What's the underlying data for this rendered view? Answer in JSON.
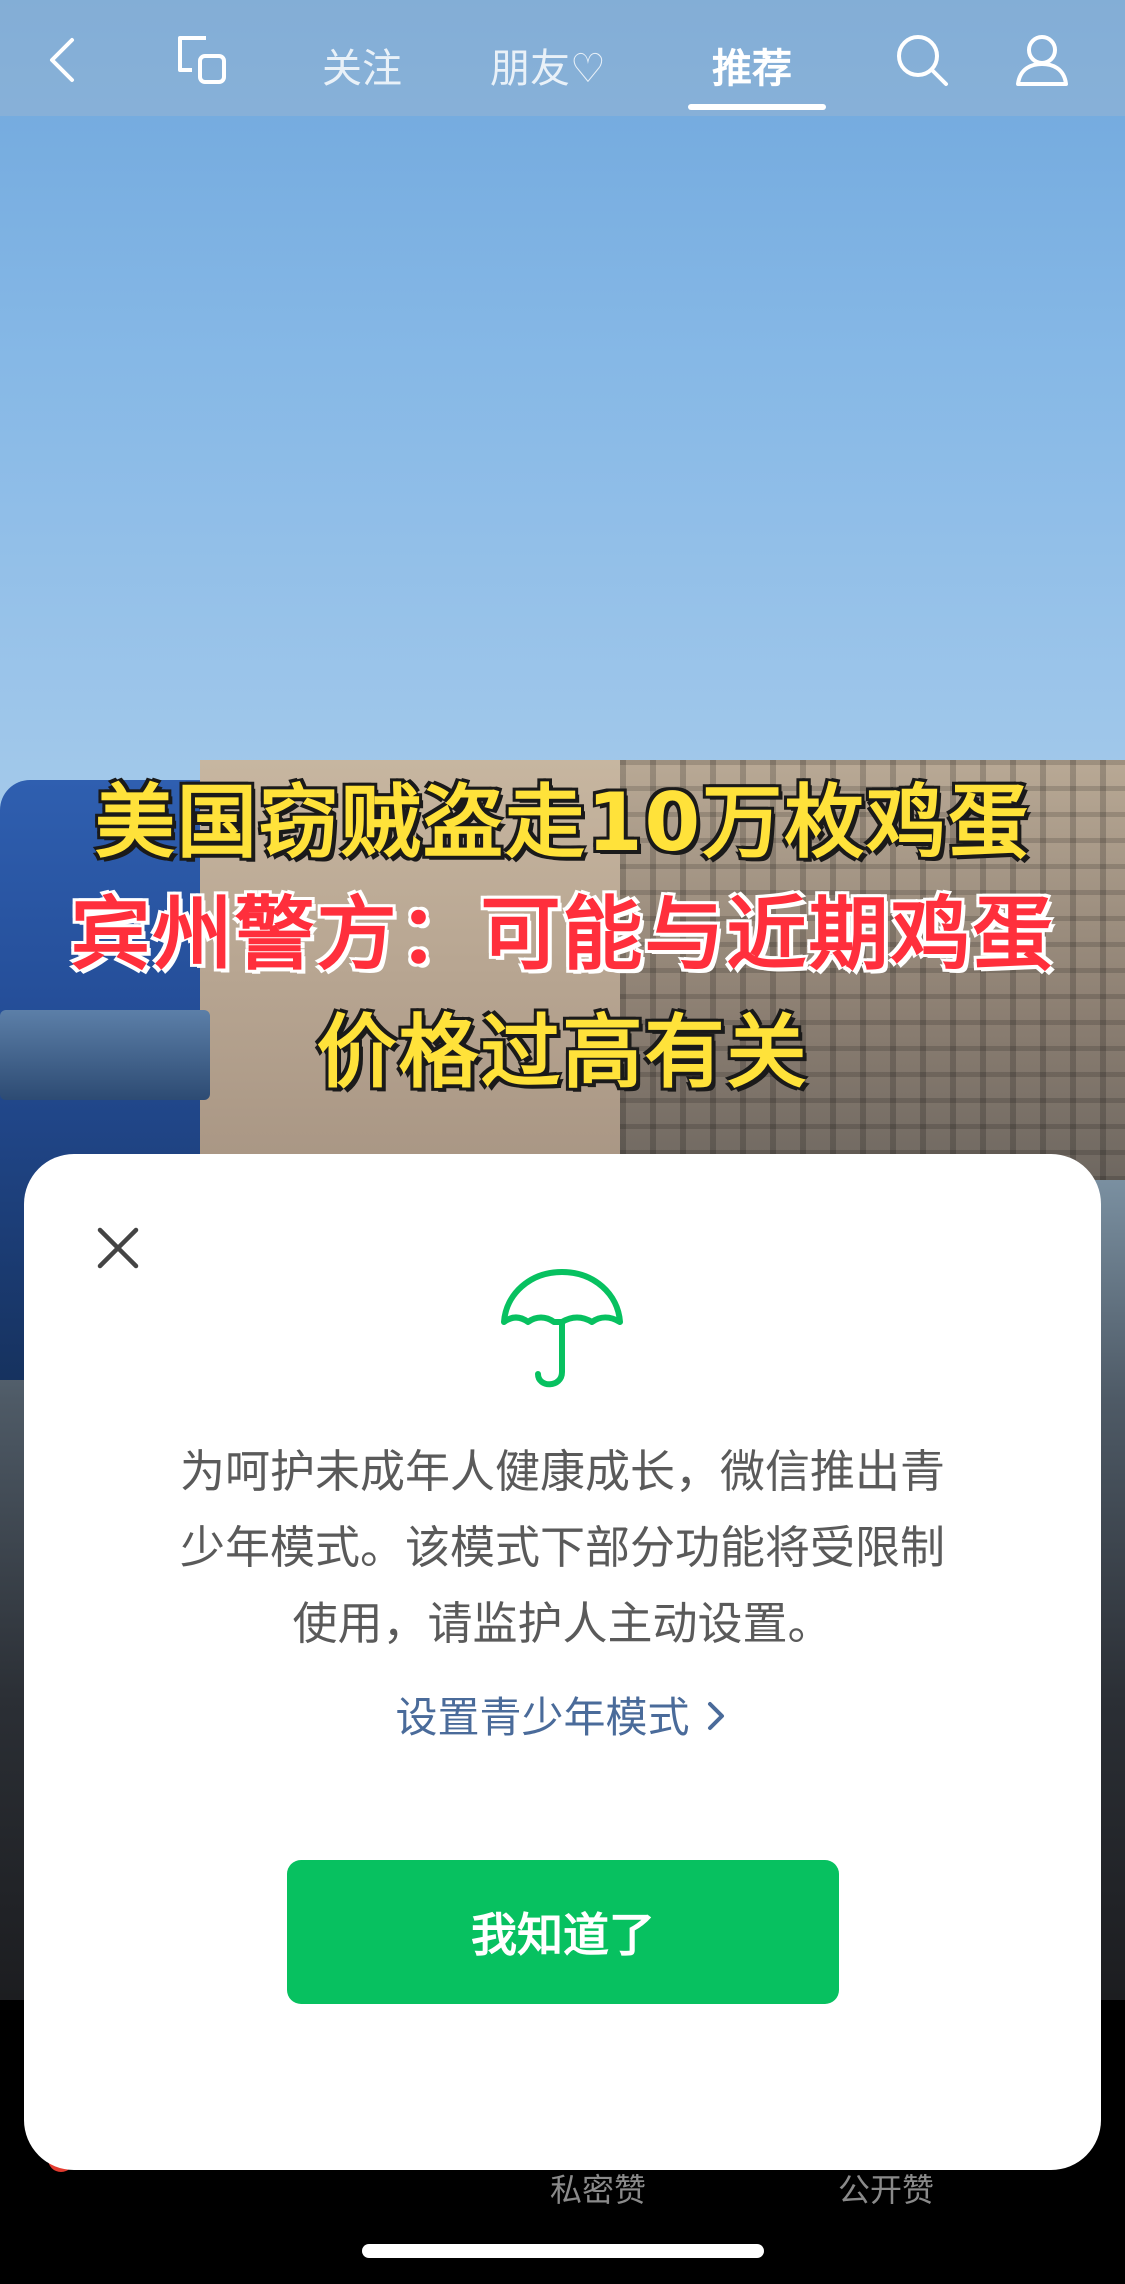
{
  "video": {
    "caption_line1": "美国窃贼盗走10万枚鸡蛋",
    "caption_line2": "宾州警方：可能与近期鸡蛋",
    "caption_line3": "价格过高有关"
  },
  "topbar": {
    "tabs": [
      {
        "label": "关注",
        "active": false
      },
      {
        "label": "朋友♡",
        "active": false
      },
      {
        "label": "推荐",
        "active": true
      }
    ],
    "icons": [
      "back-icon",
      "screen-mirror-icon",
      "search-icon",
      "profile-icon"
    ]
  },
  "bottom": {
    "labels": [
      "私密赞",
      "公开赞"
    ]
  },
  "modal": {
    "icon": "umbrella-icon",
    "message": "为呵护未成年人健康成长，微信推出青少年模式。该模式下部分功能将受限制使用，请监护人主动设置。",
    "message_lines": [
      "为呵护未成年人健康成长，微信推出青",
      "少年模式。该模式下部分功能将受限制",
      "使用，请监护人主动设置。"
    ],
    "setup_link": "设置青少年模式",
    "confirm_button": "我知道了",
    "accent_color": "#07c160"
  }
}
